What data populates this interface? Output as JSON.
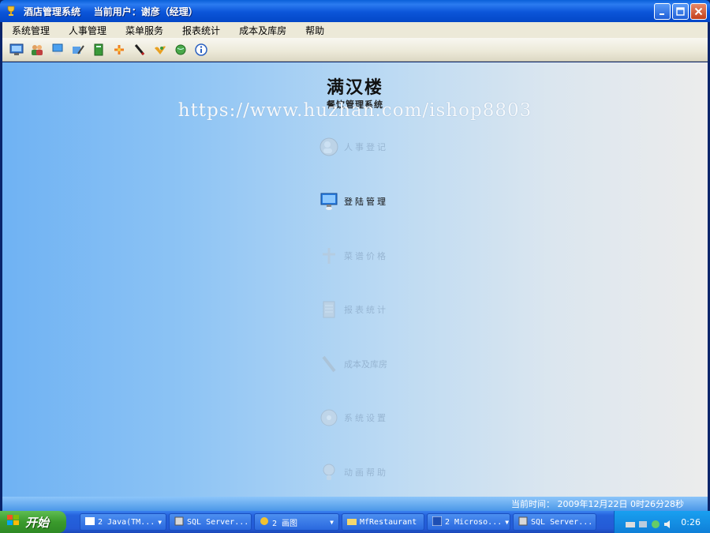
{
  "window": {
    "title": "酒店管理系统    当前用户：谢彦（经理）"
  },
  "menu": [
    "系统管理",
    "人事管理",
    "菜单服务",
    "报表统计",
    "成本及库房",
    "帮助"
  ],
  "toolbar_icons": [
    "monitor-icon",
    "users-icon",
    "screen-icon",
    "tool-icon",
    "book-icon",
    "plus-star-icon",
    "pen-icon",
    "bird-icon",
    "globe-icon",
    "info-icon"
  ],
  "brand": {
    "title": "满汉楼",
    "subtitle": "餐饮管理系统"
  },
  "watermark": "https://www.huzhan.com/ishop8803",
  "nav": [
    {
      "label": "人事登记",
      "icon": "users-icon",
      "active": false
    },
    {
      "label": "登陆管理",
      "icon": "monitor-icon",
      "active": true
    },
    {
      "label": "菜谱价格",
      "icon": "cutlery-icon",
      "active": false
    },
    {
      "label": "报表统计",
      "icon": "report-icon",
      "active": false
    },
    {
      "label": "成本及库房",
      "icon": "pen-icon",
      "active": false
    },
    {
      "label": "系统设置",
      "icon": "disc-icon",
      "active": false
    },
    {
      "label": "动画帮助",
      "icon": "help-icon",
      "active": false
    }
  ],
  "status": {
    "time_text": "当前时间： 2009年12月22日  0时26分28秒"
  },
  "taskbar": {
    "start": "开始",
    "tasks": [
      {
        "label": "2 Java(TM...",
        "has_arrow": true
      },
      {
        "label": "SQL Server...",
        "has_arrow": false
      },
      {
        "label": "2 画图",
        "has_arrow": true
      },
      {
        "label": "MfRestaurant",
        "has_arrow": false
      },
      {
        "label": "2 Microso...",
        "has_arrow": true
      },
      {
        "label": "SQL Server...",
        "has_arrow": false
      }
    ],
    "clock": "0:26"
  }
}
